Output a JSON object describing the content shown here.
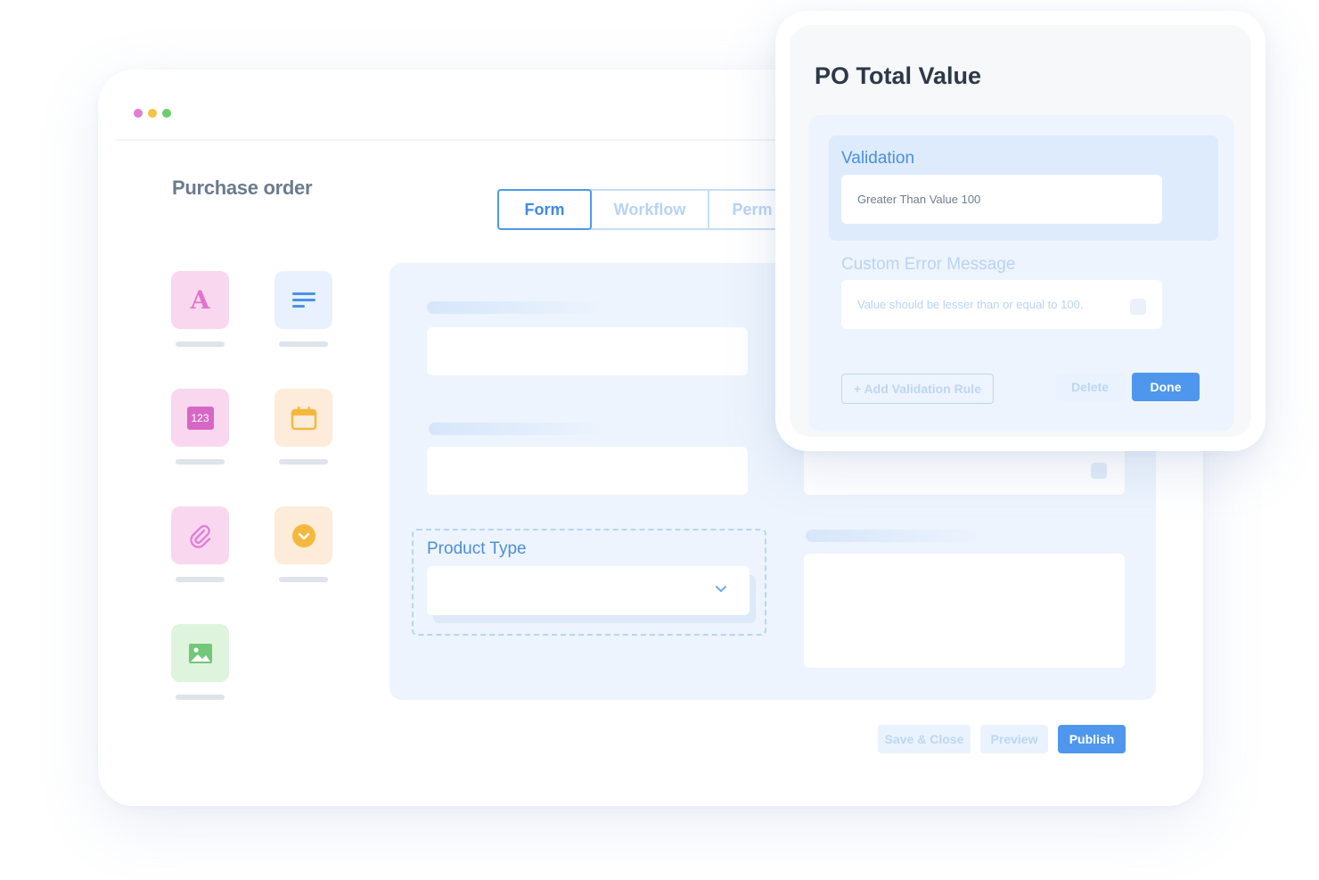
{
  "window": {
    "dots": [
      "#e07ed6",
      "#f3c443",
      "#6acd6e"
    ],
    "title": "Purchase order",
    "tabs": [
      {
        "label": "Form",
        "active": true
      },
      {
        "label": "Workflow",
        "active": false
      },
      {
        "label": "Perm",
        "active": false
      }
    ]
  },
  "palette": {
    "tools": [
      {
        "icon": "text-font-icon",
        "glyph": "A",
        "bg": "#f9d7ef",
        "color": "#e273c9"
      },
      {
        "icon": "paragraph-lines-icon",
        "bg": "#e8f1fd",
        "color": "#4a92e8"
      },
      {
        "icon": "number-icon",
        "glyph": "123",
        "bg": "#f9d7ef",
        "color": "#d767c6"
      },
      {
        "icon": "calendar-icon",
        "bg": "#fcecd9",
        "color": "#f5b83e"
      },
      {
        "icon": "paperclip-icon",
        "bg": "#f9d7ef",
        "color": "#e07ed6"
      },
      {
        "icon": "dropdown-icon",
        "bg": "#fcecd9",
        "color": "#f5b83e"
      },
      {
        "icon": "image-icon",
        "bg": "#def4dc",
        "color": "#72c779"
      }
    ]
  },
  "form": {
    "product_type_label": "Product Type"
  },
  "footer": {
    "save_close": "Save & Close",
    "preview": "Preview",
    "publish": "Publish"
  },
  "popup": {
    "title": "PO Total Value",
    "validation_label": "Validation",
    "validation_value": "Greater Than Value 100",
    "custom_error_label": "Custom Error Message",
    "custom_error_value": "Value should be lesser than or equal to 100.",
    "add_rule": "+ Add Validation Rule",
    "delete": "Delete",
    "done": "Done"
  },
  "colors": {
    "accent": "#4e97ec",
    "muted_blue": "#bcd6f3",
    "canvas_bg": "#edf4fd"
  }
}
